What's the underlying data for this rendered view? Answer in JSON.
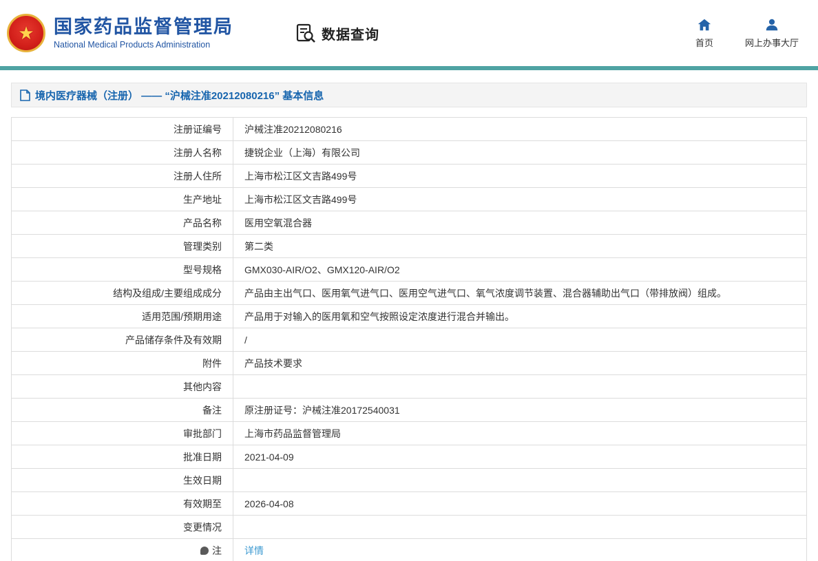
{
  "header": {
    "org_cn": "国家药品监督管理局",
    "org_en": "National Medical Products Administration",
    "query_label": "数据查询",
    "nav": [
      {
        "label": "首页",
        "icon": "home-icon"
      },
      {
        "label": "网上办事大厅",
        "icon": "user-icon"
      }
    ]
  },
  "breadcrumb": {
    "title": "境内医疗器械（注册） ——  “沪械注准20212080216” 基本信息"
  },
  "table": {
    "rows": [
      {
        "label": "注册证编号",
        "value": "沪械注准20212080216"
      },
      {
        "label": "注册人名称",
        "value": "捷锐企业（上海）有限公司"
      },
      {
        "label": "注册人住所",
        "value": "上海市松江区文吉路499号"
      },
      {
        "label": "生产地址",
        "value": "上海市松江区文吉路499号"
      },
      {
        "label": "产品名称",
        "value": "医用空氧混合器"
      },
      {
        "label": "管理类别",
        "value": "第二类"
      },
      {
        "label": "型号规格",
        "value": "GMX030-AIR/O2、GMX120-AIR/O2"
      },
      {
        "label": "结构及组成/主要组成成分",
        "value": "产品由主出气口、医用氧气进气口、医用空气进气口、氧气浓度调节装置、混合器辅助出气口（带排放阀）组成。"
      },
      {
        "label": "适用范围/预期用途",
        "value": "产品用于对输入的医用氧和空气按照设定浓度进行混合并输出。"
      },
      {
        "label": "产品储存条件及有效期",
        "value": "/"
      },
      {
        "label": "附件",
        "value": "产品技术要求"
      },
      {
        "label": "其他内容",
        "value": ""
      },
      {
        "label": "备注",
        "value": "原注册证号：沪械注准20172540031"
      },
      {
        "label": "审批部门",
        "value": "上海市药品监督管理局"
      },
      {
        "label": "批准日期",
        "value": "2021-04-09"
      },
      {
        "label": "生效日期",
        "value": ""
      },
      {
        "label": "有效期至",
        "value": "2026-04-08"
      },
      {
        "label": "变更情况",
        "value": ""
      },
      {
        "label": "注",
        "value": "详情",
        "link": true,
        "icon": "note-icon"
      }
    ]
  },
  "colors": {
    "brand_blue": "#2155a3",
    "section_blue": "#1765ae",
    "teal": "#4fa3a3",
    "link_blue": "#3d9ad1",
    "border": "#dcdcdc"
  }
}
